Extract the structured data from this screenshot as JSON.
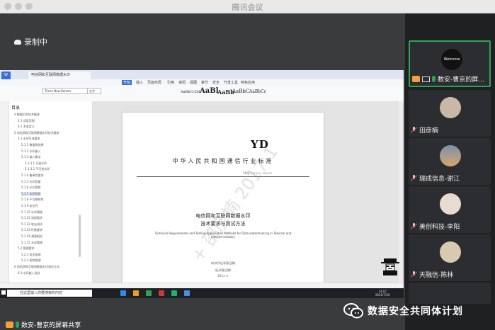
{
  "window": {
    "title": "腾讯会议"
  },
  "recording": {
    "label": "录制中"
  },
  "shared_screen": {
    "wps": {
      "menu": [
        "开始",
        "插入",
        "页面布局",
        "引用",
        "审阅",
        "视图",
        "章节",
        "安全",
        "开发工具",
        "特色应用"
      ],
      "font_name": "Times New Roman",
      "font_size": "五号",
      "styles": [
        "AaBbCcDd",
        "AaBl",
        "AaBb",
        "AaBbC",
        "AaBbCc"
      ],
      "nav": {
        "title": "目录",
        "items": [
          "4  数据识别技术概述",
          "4.1  适用范围",
          "4.2  术语定义",
          "5  电信网和互联网数据水印技术要求",
          "5.1  水印生成要求",
          "5.1.1  数据源选择",
          "5.1.2  水印嵌入",
          "5.1.3  嵌入算法",
          "5.1.3.1  可逆水印",
          "5.1.3.2  不可逆水印",
          "5.1.4  鲁棒性要求",
          "5.1.5  水印容量",
          "5.1.6  水印提取",
          "5.1.7  水印检测",
          "5.1.8  不可感知性",
          "5.1.9  安全性",
          "5.1.10  水印溯源",
          "5.1.11  流程要求",
          "5.1.12  攻击测试",
          "5.1.13  性能要求",
          "5.1.14  溯源报告",
          "5.1.15  水印管理",
          "5.2  管理要求",
          "5.2.1  安全管理",
          "5.2.2  密钥管理",
          "6  电信网和互联网数据水印测试方法",
          "6.1  水印嵌入测试"
        ]
      },
      "document": {
        "logo": "YD",
        "org_title": "中华人民共和国通信行业标准",
        "std_number": "YD/T ××××—××××",
        "doc_title_1": "电信网和互联网数据水印",
        "doc_title_2": "技术要求与测试方法",
        "en_title": "Technical Requirements and Testing Approaches Methods for Data watermarking in Telecom and Internet Industry",
        "draft_note": "(本文件征求意见稿)",
        "draft_stage": "(征求意见稿)",
        "year": "201×-×",
        "watermark": "+ 邵彦楠 2017-1"
      }
    },
    "taskbar": {
      "search_placeholder": "在这里输入你要搜索的内容",
      "time": "14:07",
      "date": "2022/7/26"
    }
  },
  "presenter": {
    "label": "数安-曹京的屏幕共享"
  },
  "participants": [
    {
      "name": "数安-曹京的屏...",
      "avatar_text": "Welcome",
      "active": true,
      "screen_share": true,
      "mic_on": true
    },
    {
      "name": "田彦楠",
      "active": false,
      "screen_share": false,
      "mic_on": false
    },
    {
      "name": "瑞成信息-谢江",
      "active": false,
      "screen_share": false,
      "mic_on": false
    },
    {
      "name": "美创科技-李阳",
      "active": false,
      "screen_share": false,
      "mic_on": false
    },
    {
      "name": "天融信-陈林",
      "active": false,
      "screen_share": false,
      "mic_on": false
    }
  ],
  "overlay": {
    "brand": "数据安全共同体计划"
  },
  "colors": {
    "accent_green": "#2ea354",
    "orange": "#f2a13a",
    "taskbar": "#1f2026"
  }
}
